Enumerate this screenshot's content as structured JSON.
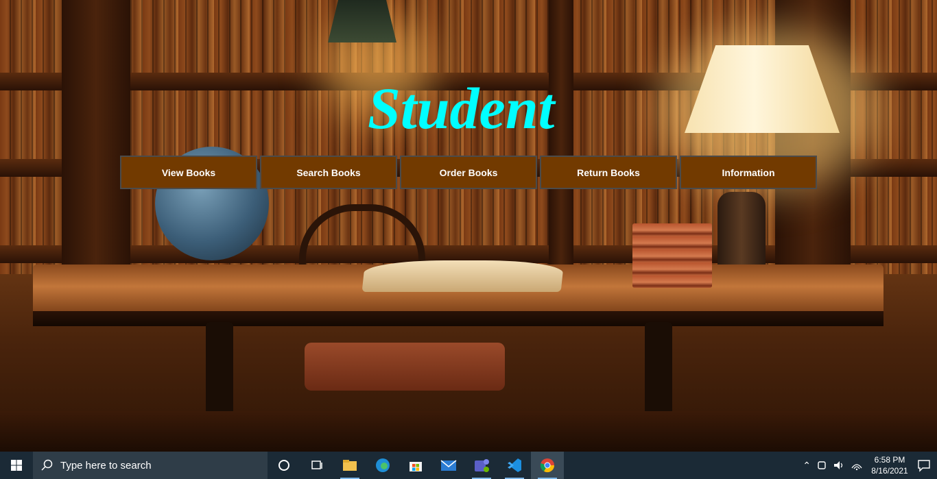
{
  "app": {
    "title": "Student",
    "accent_color": "#00ffff",
    "button_bg": "#723a00"
  },
  "nav": {
    "items": [
      {
        "label": "View Books"
      },
      {
        "label": "Search Books"
      },
      {
        "label": "Order Books"
      },
      {
        "label": "Return Books"
      },
      {
        "label": "Information"
      }
    ]
  },
  "taskbar": {
    "search_placeholder": "Type here to search",
    "time": "6:58 PM",
    "date": "8/16/2021",
    "pinned_icons": [
      "cortana-icon",
      "task-view-icon",
      "file-explorer-icon",
      "edge-icon",
      "store-icon",
      "mail-icon",
      "teams-icon",
      "vscode-icon",
      "chrome-icon"
    ]
  }
}
